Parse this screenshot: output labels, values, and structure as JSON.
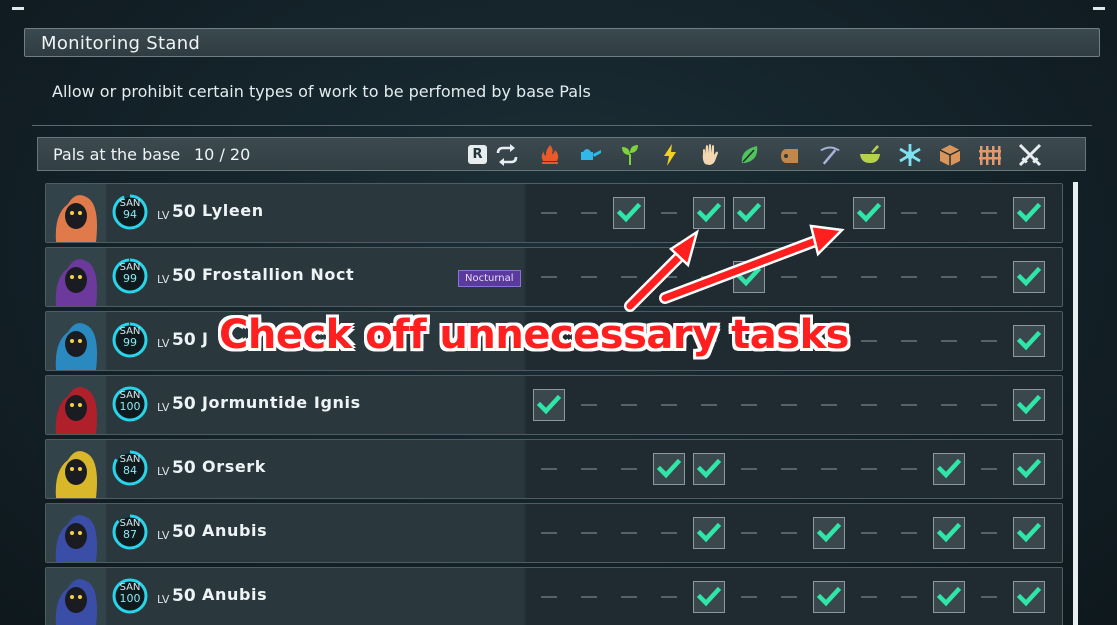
{
  "window": {
    "title": "Monitoring Stand"
  },
  "subtitle": "Allow or prohibit certain types of work to be perfomed by base Pals",
  "header": {
    "label": "Pals at the base",
    "count": "10 / 20",
    "r_key": "R",
    "cycle_icon": "cycle-icon",
    "work_icons": [
      {
        "name": "kindling-icon",
        "color": "#e85a2a"
      },
      {
        "name": "watering-icon",
        "color": "#2fb8e8"
      },
      {
        "name": "planting-icon",
        "color": "#7ed23a"
      },
      {
        "name": "electricity-icon",
        "color": "#f2d21c"
      },
      {
        "name": "handiwork-icon",
        "color": "#f3d7b0"
      },
      {
        "name": "gathering-icon",
        "color": "#4fc45a"
      },
      {
        "name": "lumbering-icon",
        "color": "#c4874a"
      },
      {
        "name": "mining-icon",
        "color": "#a7b3d8"
      },
      {
        "name": "medicine-icon",
        "color": "#b6d24a"
      },
      {
        "name": "cooling-icon",
        "color": "#7fe0f0"
      },
      {
        "name": "transporting-icon",
        "color": "#d9955a"
      },
      {
        "name": "farming-icon",
        "color": "#e39a6a"
      },
      {
        "name": "combat-icon",
        "color": "#e8eef0"
      }
    ]
  },
  "san_label": "SAN",
  "lv_label": "LV",
  "pals": [
    {
      "name": "Lyleen",
      "san": "94",
      "level": "50",
      "badge": "",
      "portrait_color": "#e07a4a",
      "checks": [
        false,
        false,
        true,
        false,
        true,
        true,
        false,
        false,
        true,
        false,
        false,
        false,
        true
      ],
      "san_fraction": 0.94
    },
    {
      "name": "Frostallion Noct",
      "san": "99",
      "level": "50",
      "badge": "Nocturnal",
      "portrait_color": "#6b3a9c",
      "checks": [
        false,
        false,
        false,
        false,
        false,
        true,
        false,
        false,
        false,
        false,
        false,
        false,
        true
      ],
      "san_fraction": 0.99
    },
    {
      "name": "J",
      "san": "99",
      "level": "50",
      "badge": "",
      "portrait_color": "#2a8ac0",
      "checks": [
        false,
        false,
        false,
        false,
        false,
        false,
        false,
        false,
        false,
        false,
        false,
        false,
        true
      ],
      "san_fraction": 0.99
    },
    {
      "name": "Jormuntide Ignis",
      "san": "100",
      "level": "50",
      "badge": "",
      "portrait_color": "#b0202a",
      "checks": [
        true,
        false,
        false,
        false,
        false,
        false,
        false,
        false,
        false,
        false,
        false,
        false,
        true
      ],
      "san_fraction": 1.0
    },
    {
      "name": "Orserk",
      "san": "84",
      "level": "50",
      "badge": "",
      "portrait_color": "#d8b82a",
      "checks": [
        false,
        false,
        false,
        true,
        true,
        false,
        false,
        false,
        false,
        false,
        true,
        false,
        true
      ],
      "san_fraction": 0.84
    },
    {
      "name": "Anubis",
      "san": "87",
      "level": "50",
      "badge": "",
      "portrait_color": "#3a4ea8",
      "checks": [
        false,
        false,
        false,
        false,
        true,
        false,
        false,
        true,
        false,
        false,
        true,
        false,
        true
      ],
      "san_fraction": 0.87
    },
    {
      "name": "Anubis",
      "san": "100",
      "level": "50",
      "badge": "",
      "portrait_color": "#3a4ea8",
      "checks": [
        false,
        false,
        false,
        false,
        true,
        false,
        false,
        true,
        false,
        false,
        true,
        false,
        true
      ],
      "san_fraction": 1.0
    }
  ],
  "annotation": {
    "text": "Check off unnecessary tasks",
    "color": "#ff1f1f"
  }
}
